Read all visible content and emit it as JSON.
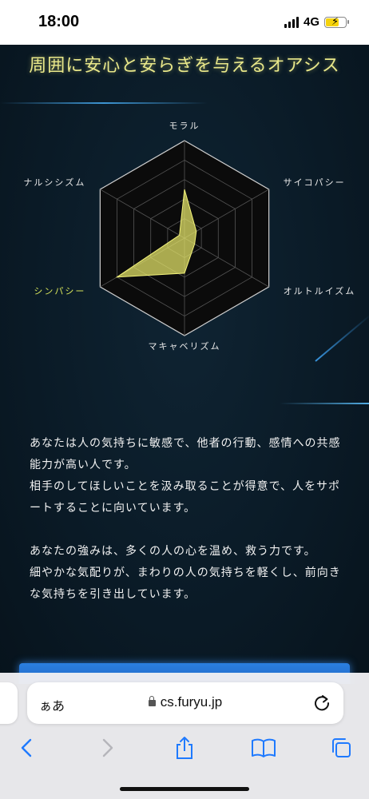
{
  "status_bar": {
    "time": "18:00",
    "network": "4G",
    "signal_bars": 4,
    "battery_level": 0.6,
    "battery_charging": true,
    "icons": [
      "signal-icon",
      "battery-charging-icon"
    ]
  },
  "page": {
    "headline": "周囲に安心と安らぎを与えるオアシス",
    "chart_data": {
      "type": "radar",
      "axes": [
        "モラル",
        "サイコパシー",
        "オルトルイズム",
        "マキャベリズム",
        "シンパシー",
        "ナルシシズム"
      ],
      "highlighted_axis": "シンパシー",
      "grid_levels": 5,
      "range": [
        0,
        5
      ],
      "values": [
        2.5,
        0.7,
        0.6,
        1.8,
        4.0,
        0.3
      ],
      "fill_color": "#e8e86a",
      "grid_color": "#555555",
      "background_color": "#0b0b0b"
    },
    "paragraphs": [
      "あなたは人の気持ちに敏感で、他者の行動、感情への共感能力が高い人です。",
      "相手のしてほしいことを汲み取ることが得意で、人をサポートすることに向いています。",
      "あなたの強みは、多くの人の心を温め、救う力です。",
      "細やかな気配りが、まわりの人の気持ちを軽くし、前向きな気持ちを引き出しています。"
    ],
    "accent_color": "#e9e88a",
    "button_color": "#2b7fe0"
  },
  "browser": {
    "aa_label": "ぁあ",
    "url": "cs.furyu.jp",
    "icons": [
      "lock-icon",
      "reload-icon",
      "back-icon",
      "forward-icon",
      "share-icon",
      "bookmarks-icon",
      "tabs-icon"
    ]
  }
}
